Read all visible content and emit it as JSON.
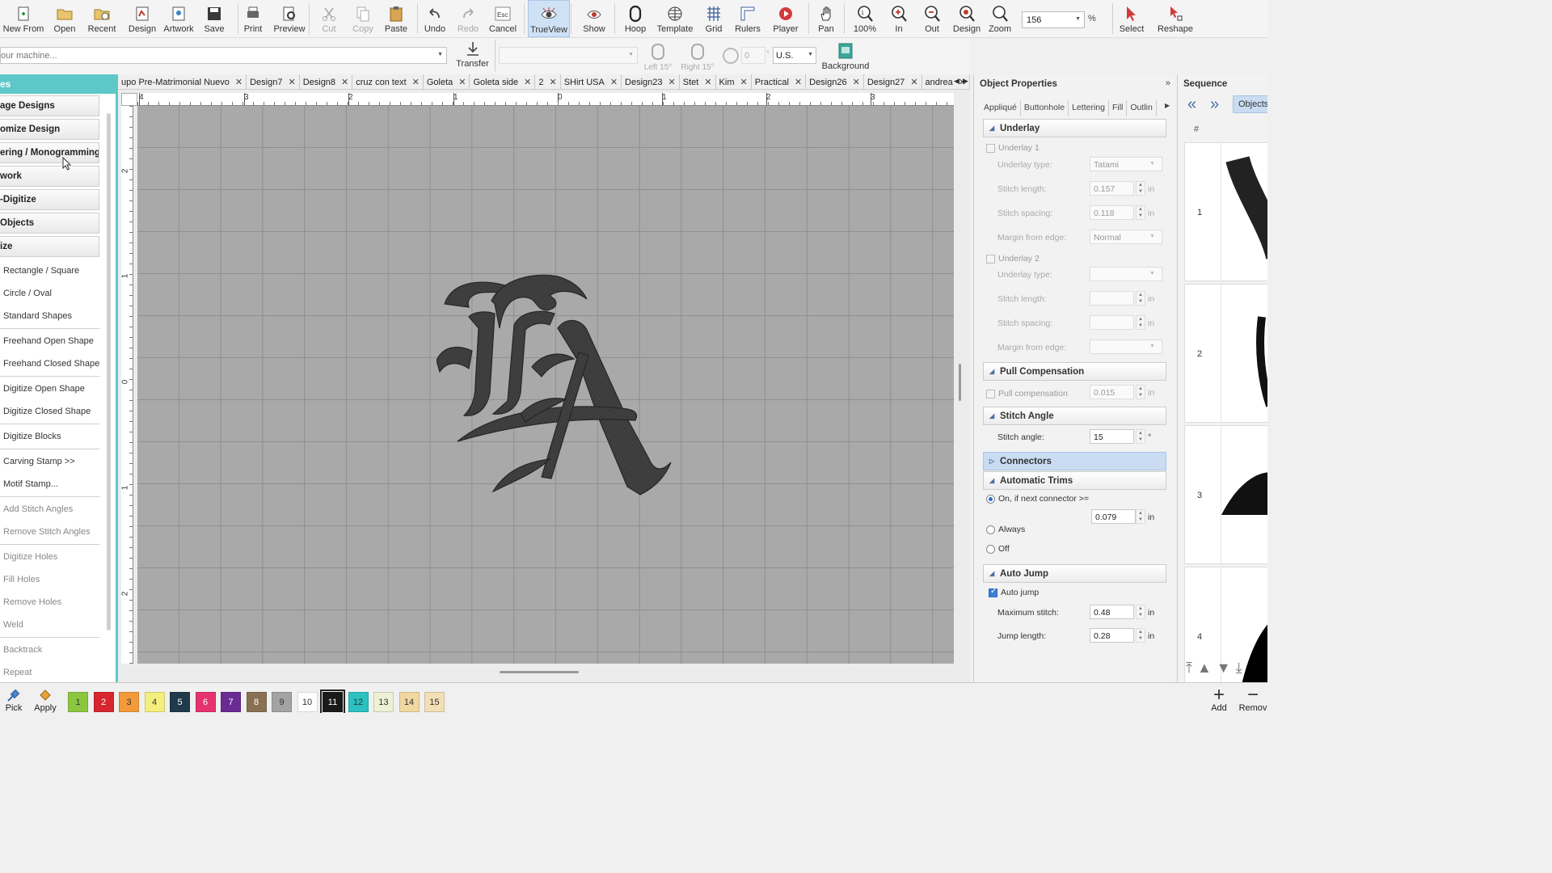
{
  "toolbar": {
    "buttons": [
      {
        "label": "New From",
        "icon": "new-file-icon"
      },
      {
        "label": "Open",
        "icon": "folder-open-icon"
      },
      {
        "label": "Recent",
        "icon": "recent-folder-icon"
      },
      {
        "label": "Design",
        "icon": "design-icon"
      },
      {
        "label": "Artwork",
        "icon": "artwork-icon"
      },
      {
        "label": "Save",
        "icon": "save-icon"
      },
      {
        "label": "Print",
        "icon": "print-icon"
      },
      {
        "label": "Preview",
        "icon": "preview-icon"
      },
      {
        "label": "Cut",
        "icon": "cut-icon"
      },
      {
        "label": "Copy",
        "icon": "copy-icon"
      },
      {
        "label": "Paste",
        "icon": "paste-icon"
      },
      {
        "label": "Undo",
        "icon": "undo-icon"
      },
      {
        "label": "Redo",
        "icon": "redo-icon"
      },
      {
        "label": "Cancel",
        "icon": "esc-icon",
        "key": "Esc"
      },
      {
        "label": "TrueView",
        "icon": "trueview-icon"
      },
      {
        "label": "Show",
        "icon": "show-icon"
      },
      {
        "label": "Hoop",
        "icon": "hoop-icon"
      },
      {
        "label": "Template",
        "icon": "template-icon"
      },
      {
        "label": "Grid",
        "icon": "grid-icon"
      },
      {
        "label": "Rulers",
        "icon": "rulers-icon"
      },
      {
        "label": "Player",
        "icon": "player-icon"
      },
      {
        "label": "Pan",
        "icon": "pan-hand-icon"
      },
      {
        "label": "100%",
        "icon": "zoom-100-icon"
      },
      {
        "label": "In",
        "icon": "zoom-in-icon"
      },
      {
        "label": "Out",
        "icon": "zoom-out-icon"
      },
      {
        "label": "Design",
        "icon": "zoom-design-icon"
      },
      {
        "label": "Zoom",
        "icon": "zoom-icon"
      },
      {
        "label": "Select",
        "icon": "select-arrow-icon"
      },
      {
        "label": "Reshape",
        "icon": "reshape-icon"
      }
    ],
    "zoom_value": "156",
    "zoom_unit": "%"
  },
  "toolbar2": {
    "machine_placeholder": "our machine...",
    "transfer_label": "Transfer",
    "left15": "Left 15°",
    "right15": "Right 15°",
    "rotate_value": "0",
    "units_value": "U.S.",
    "background_label": "Background"
  },
  "left_panel": {
    "header": "es",
    "sections": [
      "age Designs",
      "omize Design",
      "ering / Monogramming",
      "work",
      "-Digitize",
      "Objects",
      "ize"
    ],
    "items": [
      {
        "label": "Rectangle / Square",
        "dim": false,
        "sep": false
      },
      {
        "label": "Circle / Oval",
        "dim": false,
        "sep": false
      },
      {
        "label": "Standard Shapes",
        "dim": false,
        "sep": true
      },
      {
        "label": "Freehand Open Shape",
        "dim": false,
        "sep": false
      },
      {
        "label": "Freehand Closed Shape",
        "dim": false,
        "sep": true
      },
      {
        "label": "Digitize Open Shape",
        "dim": false,
        "sep": false
      },
      {
        "label": "Digitize Closed Shape",
        "dim": false,
        "sep": true
      },
      {
        "label": "Digitize Blocks",
        "dim": false,
        "sep": true
      },
      {
        "label": "Carving Stamp >>",
        "dim": false,
        "sep": false
      },
      {
        "label": "Motif Stamp...",
        "dim": false,
        "sep": true
      },
      {
        "label": "Add Stitch Angles",
        "dim": true,
        "sep": false
      },
      {
        "label": "Remove Stitch Angles",
        "dim": true,
        "sep": true
      },
      {
        "label": "Digitize Holes",
        "dim": true,
        "sep": false
      },
      {
        "label": "Fill Holes",
        "dim": true,
        "sep": false
      },
      {
        "label": "Remove Holes",
        "dim": true,
        "sep": false
      },
      {
        "label": "Weld",
        "dim": true,
        "sep": true
      },
      {
        "label": "Backtrack",
        "dim": true,
        "sep": false
      },
      {
        "label": "Repeat",
        "dim": true,
        "sep": false
      }
    ]
  },
  "tabs": [
    "upo Pre-Matrimonial Nuevo",
    "Design7",
    "Design8",
    "cruz con text",
    "Goleta",
    "Goleta side",
    "2",
    "SHirt USA",
    "Design23",
    "Stet",
    "Kim",
    "Practical",
    "Design26",
    "Design27",
    "andrea"
  ],
  "rulers": {
    "h": [
      "4",
      "3",
      "2",
      "1",
      "0",
      "1",
      "2",
      "3"
    ],
    "v": [
      "2",
      "1",
      "0",
      "1",
      "2"
    ]
  },
  "properties": {
    "title": "Object Properties",
    "tabs": [
      "Appliqué",
      "Buttonhole",
      "Lettering",
      "Fill",
      "Outlin"
    ],
    "underlay": {
      "header": "Underlay",
      "u1_label": "Underlay 1",
      "u1_type_label": "Underlay type:",
      "u1_type_value": "Tatami",
      "u1_len_label": "Stitch length:",
      "u1_len_value": "0.157",
      "u1_sp_label": "Stitch spacing:",
      "u1_sp_value": "0.118",
      "u1_margin_label": "Margin from edge:",
      "u1_margin_value": "Normal",
      "u2_label": "Underlay 2",
      "u2_type_label": "Underlay type:",
      "u2_len_label": "Stitch length:",
      "u2_sp_label": "Stitch spacing:",
      "u2_margin_label": "Margin from edge:",
      "unit": "in"
    },
    "pull": {
      "header": "Pull Compensation",
      "label": "Pull compensation",
      "value": "0.015",
      "unit": "in"
    },
    "angle": {
      "header": "Stitch Angle",
      "label": "Stitch angle:",
      "value": "15",
      "unit": "°"
    },
    "connectors": {
      "header": "Connectors"
    },
    "trims": {
      "header": "Automatic Trims",
      "opt1": "On, if next connector >=",
      "value": "0.079",
      "unit": "in",
      "opt2": "Always",
      "opt3": "Off"
    },
    "jump": {
      "header": "Auto Jump",
      "chk": "Auto jump",
      "max_label": "Maximum stitch:",
      "max_value": "0.48",
      "len_label": "Jump length:",
      "len_value": "0.28",
      "unit": "in"
    }
  },
  "sequence": {
    "title": "Sequence",
    "objects_label": "Objects",
    "col_header": "#",
    "rows": [
      "1",
      "2",
      "3",
      "4"
    ]
  },
  "bottom": {
    "pick": "Pick",
    "apply": "Apply",
    "add": "Add",
    "remove": "Remov",
    "swatches": [
      {
        "n": "1",
        "c": "#8cc63f"
      },
      {
        "n": "2",
        "c": "#d7262e"
      },
      {
        "n": "3",
        "c": "#f39a3b"
      },
      {
        "n": "4",
        "c": "#f4ee7e"
      },
      {
        "n": "5",
        "c": "#1f3a4a"
      },
      {
        "n": "6",
        "c": "#e6336f"
      },
      {
        "n": "7",
        "c": "#6a2b93"
      },
      {
        "n": "8",
        "c": "#8a7052"
      },
      {
        "n": "9",
        "c": "#a3a3a3"
      },
      {
        "n": "10",
        "c": "#ffffff"
      },
      {
        "n": "11",
        "c": "#1a1a1a"
      },
      {
        "n": "12",
        "c": "#2bc1c1"
      },
      {
        "n": "13",
        "c": "#eef0d6"
      },
      {
        "n": "14",
        "c": "#f1d7a0"
      },
      {
        "n": "15",
        "c": "#f3dfb6"
      }
    ]
  }
}
